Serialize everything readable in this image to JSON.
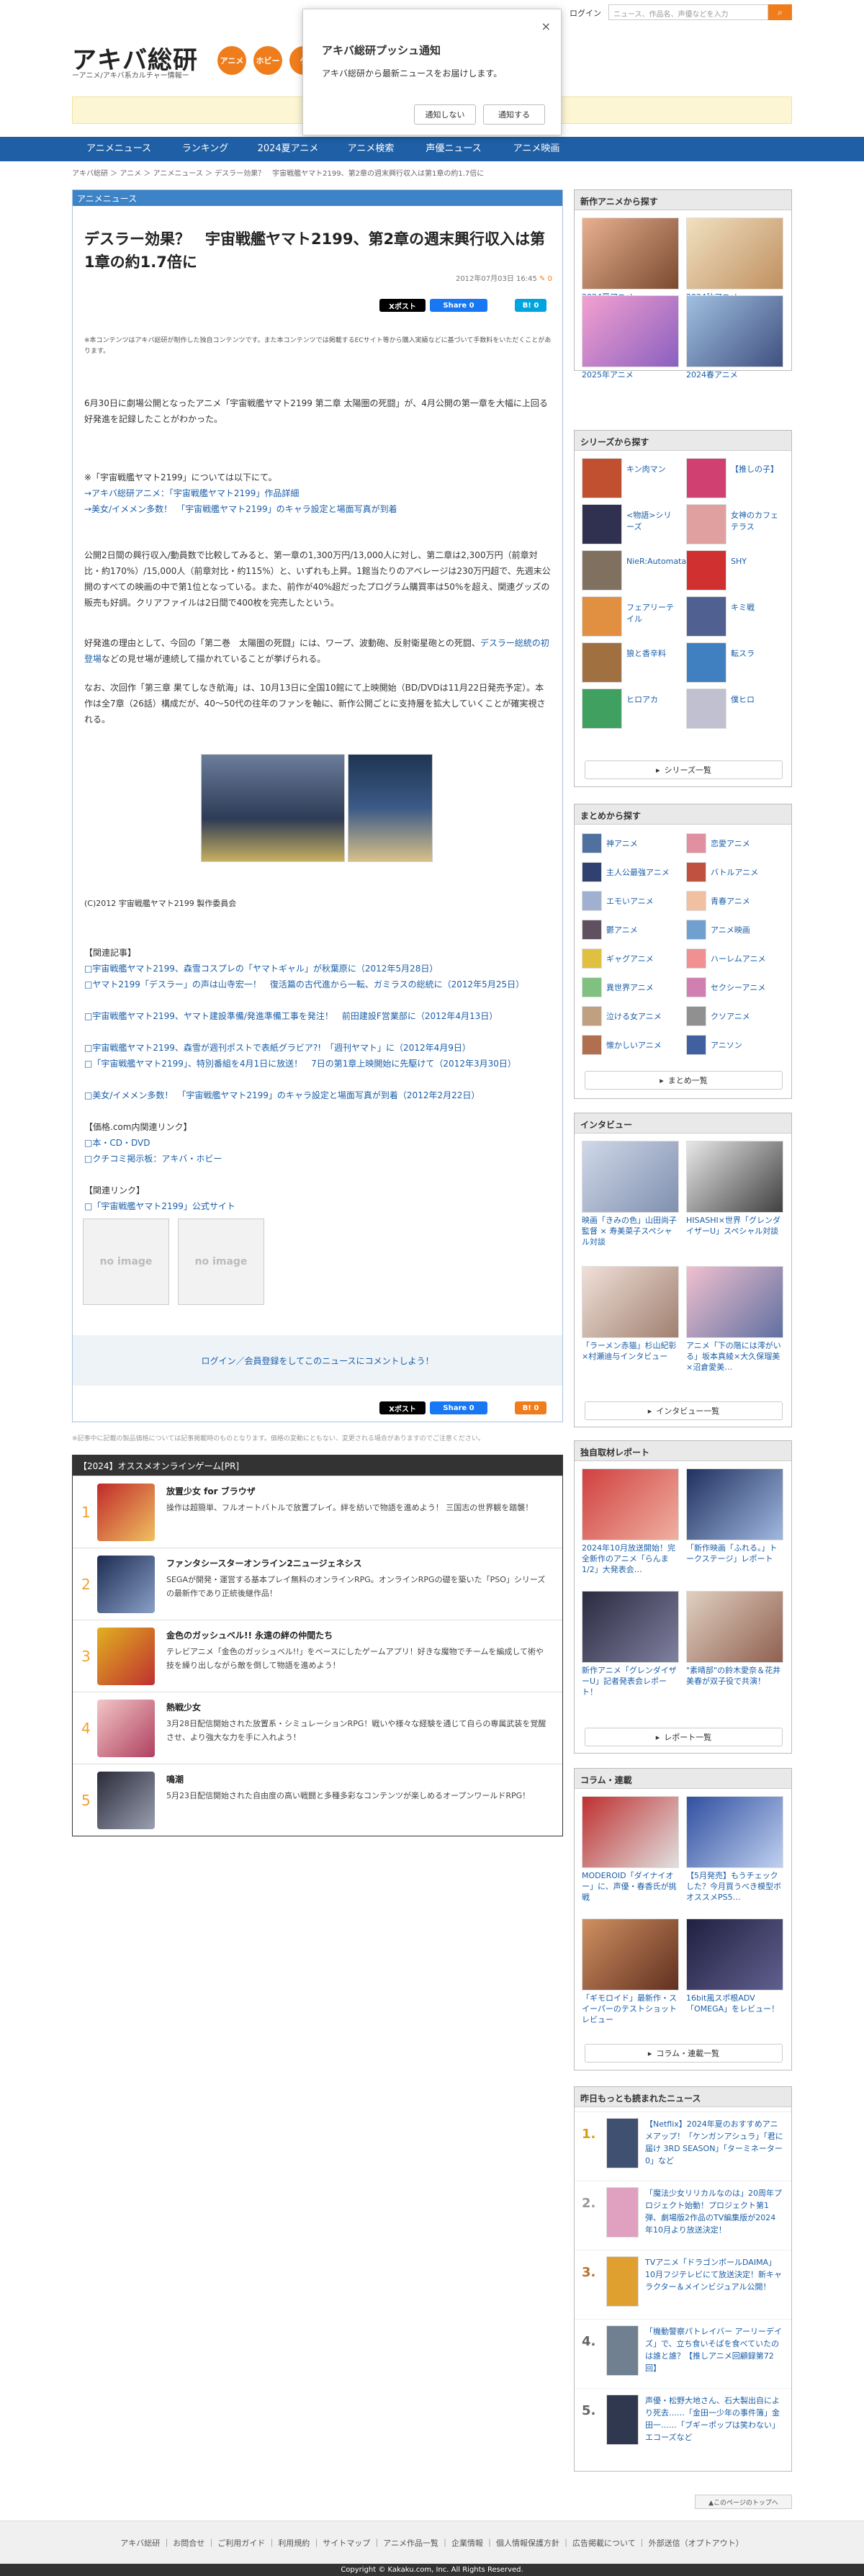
{
  "site": {
    "logo": "アキバ総研",
    "logo_sub": "ーアニメ/アキバ系カルチャー情報ー",
    "categories": [
      "アニメ",
      "ホビー",
      "ゲ"
    ],
    "login": "ログイン",
    "search_placeholder": "ニュース、作品名、声優などを入力"
  },
  "popup": {
    "title": "アキバ総研プッシュ通知",
    "body": "アキバ総研から最新ニュースをお届けします。",
    "decline": "通知しない",
    "accept": "通知する",
    "close": "×"
  },
  "nav": [
    "アニメニュース",
    "ランキング",
    "2024夏アニメ",
    "アニメ検索",
    "声優ニュース",
    "アニメ映画"
  ],
  "breadcrumb": "アキバ総研 ＞ アニメ ＞ アニメニュース ＞ デスラー効果？　宇宙戦艦ヤマト2199、第2章の週末興行収入は第1章の約1.7倍に",
  "article": {
    "section": "アニメニュース",
    "title": "デスラー効果？　宇宙戦艦ヤマト2199、第2章の週末興行収入は第1章の約1.7倍に",
    "date": "2012年07月03日 16:45",
    "comment_count": "0",
    "share": {
      "x": "Xポスト",
      "fb": "Share 0",
      "hb": "B! 0"
    },
    "note": "※本コンテンツはアキバ総研が制作した独自コンテンツです。また本コンテンツでは掲載するECサイト等から購入実績などに基づいて手数料をいただくことがあります。",
    "p1": "6月30日に劇場公開となったアニメ「宇宙戦艦ヤマト2199 第二章 太陽圏の死闘」が、4月公開の第一章を大幅に上回る好発進を記録したことがわかった。",
    "p2_head": "※「宇宙戦艦ヤマト2199」については以下にて。",
    "p2_link1": "→アキバ総研アニメ：「宇宙戦艦ヤマト2199」作品詳細",
    "p2_link2": "→美女/イメメン多数！　「宇宙戦艦ヤマト2199」のキャラ設定と場面写真が到着",
    "p3": "公開2日間の興行収入/動員数で比較してみると、第一章の1,300万円/13,000人に対し、第二章は2,300万円（前章対比・約170%）/15,000人（前章対比・約115%）と、いずれも上昇。1館当たりのアベレージは230万円超で、先週末公開のすべての映画の中で第1位となっている。また、前作が40%超だったプログラム購買率は50%を超え、関連グッズの販売も好調。クリアファイルは2日間で400枚を完売したという。",
    "p4_a": "好発進の理由として、今回の「第二巻　太陽圏の死闘」には、ワープ、波動砲、反射衛星砲との死闘、",
    "p4_link": "デスラー総統の初登場",
    "p4_b": "などの見せ場が連続して描かれていることが挙げられる。",
    "p5": "なお、次回作「第三章 果てしなき航海」は、10月13日に全国10館にて上映開始（BD/DVDは11月22日発売予定）。本作は全7章（26話）構成だが、40〜50代の往年のファンを軸に、新作公開ごとに支持層を拡大していくことが確実視される。",
    "copyright_note": "(C)2012 宇宙戦艦ヤマト2199 製作委員会",
    "related_head": "【関連記事】",
    "related": [
      "□宇宙戦艦ヤマト2199、森雪コスプレの「ヤマトギャル」が秋葉原に（2012年5月28日）",
      "□ヤマト2199「デスラー」の声は山寺宏一！　復活篇の古代進から一転、ガミラスの総統に（2012年5月25日）",
      "□宇宙戦艦ヤマト2199、ヤマト建設準備/発進準備工事を発注！　前田建設F営業部に（2012年4月13日）",
      "□宇宙戦艦ヤマト2199、森雪が週刊ポストで表紙グラビア?!　「週刊ヤマト」に（2012年4月9日）",
      "□「宇宙戦艦ヤマト2199」、特別番組を4月1日に放送！　7日の第1章上映開始に先駆けて（2012年3月30日）",
      "□美女/イメメン多数！　「宇宙戦艦ヤマト2199」のキャラ設定と場面写真が到着（2012年2月22日）"
    ],
    "price_head": "【価格.com内関連リンク】",
    "price_links": [
      "□本・CD・DVD",
      "□クチコミ掲示板：アキバ・ホビー"
    ],
    "link_head": "【関連リンク】",
    "links": [
      "□「宇宙戦艦ヤマト2199」公式サイト"
    ],
    "noimage": "no image",
    "comment": "ログイン／会員登録をしてこのニュースにコメントしよう！"
  },
  "footnote": "※記事中に記載の製品価格については記事掲載時のものとなります。価格の変動にともない、変更される場合がありますのでご注意ください。",
  "games": {
    "head": "【2024】オススメオンラインゲーム[PR]",
    "items": [
      {
        "num": "1",
        "name": "放置少女 for ブラウザ",
        "desc": "操作は超簡単、フルオートバトルで放置プレイ。絆を紡いで物語を進めよう！ 三国志の世界観を踏襲！"
      },
      {
        "num": "2",
        "name": "ファンタシースターオンライン2ニュージェネシス",
        "desc": "SEGAが開発・運営する基本プレイ無料のオンラインRPG。オンラインRPGの礎を築いた「PSO」シリーズの最新作であり正統後継作品！"
      },
      {
        "num": "3",
        "name": "金色のガッシュベル!! 永遠の絆の仲間たち",
        "desc": "テレビアニメ「金色のガッシュベル!!」をベースにしたゲームアプリ！好きな魔物でチームを編成して術や技を繰り出しながら敵を倒して物語を進めよう！"
      },
      {
        "num": "4",
        "name": "熱戦少女",
        "desc": "3月28日配信開始された放置系・シミュレーションRPG！戦いや様々な経験を通じて自らの専属武装を覚醒させ、より強大な力を手に入れよう！"
      },
      {
        "num": "5",
        "name": "鳴潮",
        "desc": "5月23日配信開始された自由度の高い戦闘と多種多彩なコンテンツが楽しめるオープンワールドRPG！"
      }
    ]
  },
  "sidebar": {
    "new_anime": {
      "head": "新作アニメから探す",
      "items": [
        "2024夏アニメ",
        "2024秋アニメ",
        "2025年アニメ",
        "2024春アニメ"
      ]
    },
    "series": {
      "head": "シリーズから探す",
      "items": [
        "キン肉マン",
        "【推しの子】",
        "<物語>シリーズ",
        "女神のカフェテラス",
        "NieR:Automata",
        "SHY",
        "フェアリーテイル",
        "キミ戦",
        "狼と香辛料",
        "転スラ",
        "ヒロアカ",
        "僕ヒロ"
      ],
      "more": "シリーズ一覧"
    },
    "matome": {
      "head": "まとめから探す",
      "items": [
        "神アニメ",
        "恋愛アニメ",
        "主人公最強アニメ",
        "バトルアニメ",
        "エモいアニメ",
        "青春アニメ",
        "鬱アニメ",
        "アニメ映画",
        "ギャグアニメ",
        "ハーレムアニメ",
        "異世界アニメ",
        "セクシーアニメ",
        "泣ける女アニメ",
        "クソアニメ",
        "懐かしいアニメ",
        "アニソン"
      ],
      "more": "まとめ一覧"
    },
    "interview": {
      "head": "インタビュー",
      "items": [
        "映画「きみの色」山田尚子監督 × 寿美菜子スペシャル対談",
        "HISASHI×世界「グレンダイザーU」スペシャル対談",
        "「ラーメン赤猫」杉山紀彰×村瀬迪与インタビュー",
        "アニメ「下の階には澪がいる」坂本真綾×大久保瑠美×沼倉愛美…"
      ],
      "more": "インタビュー一覧"
    },
    "report": {
      "head": "独自取材レポート",
      "items": [
        "2024年10月放送開始！完全新作のアニメ「らんま1/2」大発表会…",
        "「新作映画「ふれる。」トークステージ」レポート",
        "新作アニメ「グレンダイザーU」記者発表会レポート！",
        "\"素晴部\"の鈴木愛奈＆花井美春が双子役で共演！"
      ],
      "more": "レポート一覧"
    },
    "column": {
      "head": "コラム・連載",
      "items": [
        "MODEROID「ダイナイオー」に、声優・春香氏が挑戦",
        "【5月発売】もうチェックした？今月買うべき模型ボオススメPS5…",
        "「ギモロイド」最新作・スイーパーのテストショットレビュー",
        "16bit風スポ根ADV「OMEGA」をレビュー！"
      ],
      "more": "コラム・連載一覧"
    },
    "ranking": {
      "head": "昨日もっとも読まれたニュース",
      "items": [
        {
          "num": "1.",
          "text": "【Netflix】2024年夏のおすすめアニメアップ！「ケンガンアシュラ」「君に届け 3RD SEASON」「ターミネーター0」など"
        },
        {
          "num": "2.",
          "text": "「魔法少女リリカルなのは」20周年プロジェクト始動！プロジェクト第1弾、劇場版2作品のTV編集版が2024年10月より放送決定！"
        },
        {
          "num": "3.",
          "text": "TVアニメ「ドラゴンボールDAIMA」10月フジテレビにて放送決定！新キャラクター＆メインビジュアル公開！"
        },
        {
          "num": "4.",
          "text": "「機動警察パトレイバー アーリーデイズ」で、立ち食いそばを食べていたのは誰と誰？【推しアニメ回顧録第72回】"
        },
        {
          "num": "5.",
          "text": "声優・松野大地さん、石大製出自により死去……「金田一少年の事件簿」金田一……「ブギーポップは笑わない」エコーズなど"
        }
      ]
    }
  },
  "pagetop": "▲このページのトップへ",
  "footer": {
    "links": "アキバ総研 ｜ お問合せ ｜ ご利用ガイド ｜ 利用規約 ｜ サイトマップ ｜ アニメ作品一覧 ｜ 企業情報 ｜ 個人情報保護方針 ｜ 広告掲載について ｜ 外部送信（オプトアウト）",
    "copyright": "Copyright © Kakaku.com, Inc. All Rights Reserved."
  },
  "colors": {
    "brand_orange": "#f07d1c",
    "nav_blue": "#1e5fa6",
    "link": "#1a5ea8"
  }
}
